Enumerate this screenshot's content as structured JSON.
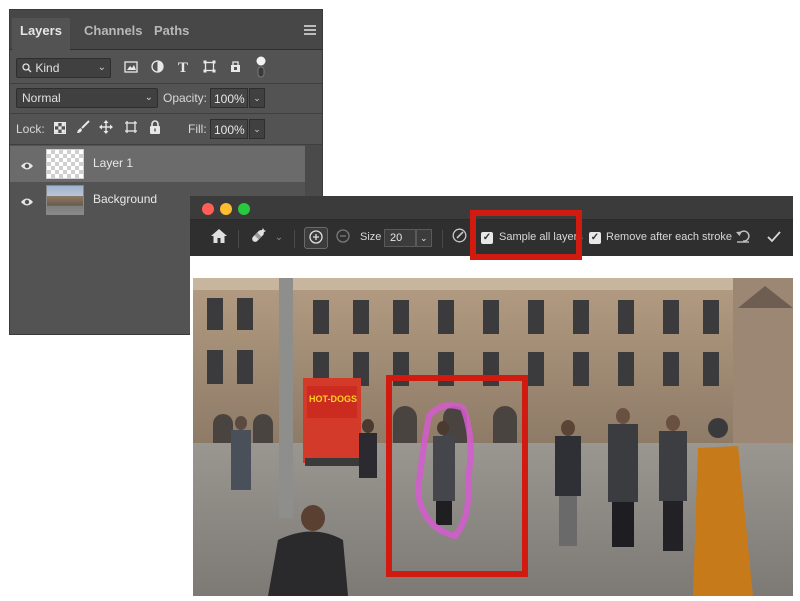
{
  "layers_panel": {
    "tabs": [
      {
        "label": "Layers",
        "active": true
      },
      {
        "label": "Channels",
        "active": false
      },
      {
        "label": "Paths",
        "active": false
      }
    ],
    "filter": {
      "value": "Kind",
      "icon": "search-icon"
    },
    "filter_icons": [
      "pixel-layer-icon",
      "adjustment-layer-icon",
      "type-layer-icon",
      "shape-layer-icon",
      "smart-object-icon",
      "filter-toggle-icon"
    ],
    "blend_mode": "Normal",
    "opacity_label": "Opacity:",
    "opacity_value": "100%",
    "lock_label": "Lock:",
    "fill_label": "Fill:",
    "fill_value": "100%",
    "layers": [
      {
        "name": "Layer 1",
        "selected": true,
        "visible": true,
        "thumbnail": "transparent"
      },
      {
        "name": "Background",
        "selected": false,
        "visible": true,
        "thumbnail": "photo"
      }
    ]
  },
  "healing_window": {
    "toolbar": {
      "size_label": "Size",
      "size_value": "20",
      "sample_all_layers": {
        "label": "Sample all layers",
        "checked": true,
        "highlighted": true
      },
      "remove_after_stroke": {
        "label": "Remove after each stroke",
        "checked": true
      }
    }
  },
  "photo": {
    "sign_text": "HOT-DOGS",
    "highlight_color": "#d11a10",
    "brush_stroke_color": "#d65ad0"
  },
  "colors": {
    "panel_bg": "#535353",
    "panel_dark": "#474747",
    "highlight_red": "#d11a10",
    "traffic_red": "#ff5f57",
    "traffic_yellow": "#febc2e",
    "traffic_green": "#28c840"
  }
}
